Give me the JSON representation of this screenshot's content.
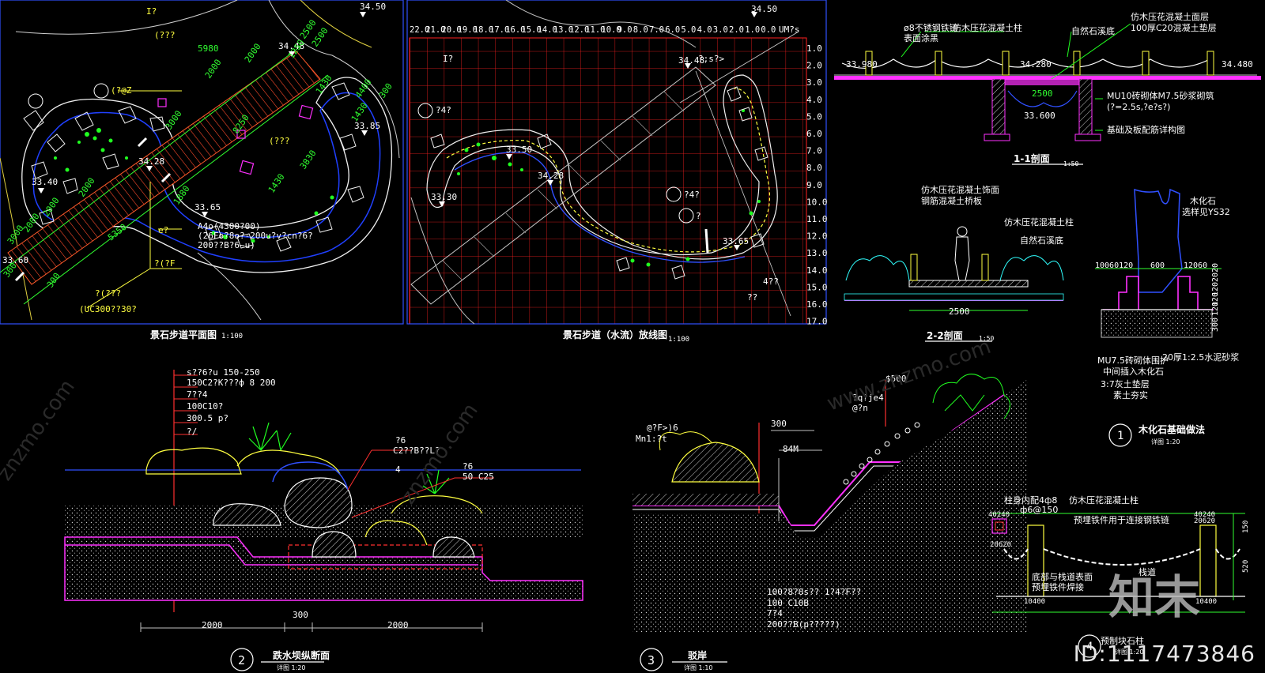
{
  "plan": {
    "title": "景石步道平面图",
    "scale": "1:100",
    "levels": [
      "34.50",
      "34.48",
      "34.28",
      "33.85",
      "33.65",
      "33.40",
      "33.60"
    ],
    "dims": [
      "2500",
      "2500",
      "1250",
      "5980",
      "2000",
      "2000",
      "1430",
      "1430",
      "8250",
      "4400",
      "3830",
      "1430",
      "1880",
      "3000",
      "2000",
      "2000",
      "5350",
      "300",
      "3000",
      "300",
      "300",
      "2000"
    ],
    "notes": [
      "A4o(4300?00)",
      "(26Fo?8o?-200u?v?cn?6?",
      "200??B?6~u)",
      "(UC300??30?",
      "?(???",
      "?(?F",
      "(???",
      "(???",
      "(?@Z",
      "I?",
      "e?"
    ]
  },
  "grid": {
    "title": "景石步道（水流）放线图",
    "scale": "1:100",
    "top_axis": [
      "22.0",
      "21.0",
      "20.0",
      "19.0",
      "18.0",
      "17.0",
      "16.0",
      "15.0",
      "14.0",
      "13.0",
      "12.0",
      "11.0",
      "10.0",
      "9.0",
      "8.0",
      "7.0",
      "6.0",
      "5.0",
      "4.0",
      "3.0",
      "2.0",
      "1.0",
      "0.0"
    ],
    "axis_unit": "UM?s",
    "right_axis": [
      "1.0",
      "2.0",
      "3.0",
      "4.0",
      "5.0",
      "6.0",
      "7.0",
      "8.0",
      "9.0",
      "10.0",
      "11.0",
      "12.0",
      "13.0",
      "14.0",
      "15.0",
      "16.0",
      "17.0"
    ],
    "levels": [
      "34.50",
      "34.48",
      "33.50",
      "34.28",
      "33.30",
      "33.65"
    ],
    "notes": [
      "?;s?>",
      "?4?",
      "?4?",
      "?",
      "4??",
      "??",
      "I?"
    ]
  },
  "section11": {
    "title": "1-1剖面",
    "scale": "1:50",
    "levels": [
      "33.980",
      "34.280",
      "34.480",
      "33.600"
    ],
    "dim": "2500",
    "notes": [
      "ø8不锈钢铁链",
      "仿木压花混凝土柱",
      "表面涂黑",
      "自然石溪底",
      "仿木压花混凝土面层",
      "100厚C20混凝土垫层",
      "MU10砖砌体M7.5砂浆砌筑",
      "(?=2.5s,?e?s?)",
      "基础及板配筋详构图"
    ]
  },
  "section22": {
    "title": "2-2剖面",
    "scale": "1:50",
    "dim": "2500",
    "notes": [
      "仿木压花混凝土饰面",
      "钢筋混凝土桥板",
      "仿木压花混凝土柱",
      "自然石溪底"
    ]
  },
  "detail1": {
    "title": "木化石基础做法",
    "scale": "详图 1:20",
    "num": "1",
    "dims_top": [
      "10060120",
      "600",
      "12060"
    ],
    "dims_side": [
      "2020",
      "120",
      "120",
      "120",
      "300"
    ],
    "label_stone": "木化石",
    "label_sample": "选样见YS32",
    "notes": [
      "MU7.5砖砌体围护",
      "20厚1:2.5水泥砂浆",
      "中间插入木化石",
      "3:7灰土垫层",
      "素土夯实"
    ]
  },
  "detail2": {
    "title": "跌水坝纵断面",
    "scale": "详图 1:20",
    "num": "2",
    "notes": [
      "s??6?u   150-250",
      "150C2?K???ф   8 200",
      "7??4",
      "100C10?",
      "300.5 p?",
      "?/"
    ],
    "callouts": [
      "?6",
      "C2??B??L?",
      "4",
      "?6",
      "50 C25"
    ],
    "dims": [
      "2000",
      "300",
      "2000"
    ]
  },
  "detail3": {
    "title": "驳岸",
    "scale": "详图 1:10",
    "num": "3",
    "notes": [
      "@?F>)6",
      "Mn1:?t",
      "?q?je4",
      "@?n",
      "$500",
      "84M",
      "300"
    ],
    "bottom_notes": [
      "100?8?0s??   1?4?F??",
      "100 C10B",
      "7?4",
      "200??B(p?????)"
    ]
  },
  "detail4": {
    "title": "预制块石柱",
    "scale": "详图 1:20",
    "num": "4",
    "notes": [
      "柱身内配4ф8",
      "ф6@150",
      "仿木压花混凝土柱",
      "预埋铁件用于连接钢铁链",
      "底部与栈道表面",
      "预埋铁件焊接",
      "栈道"
    ],
    "dims": [
      "40240",
      "20620",
      "10400",
      "40240",
      "20620",
      "10400",
      "520",
      "150"
    ]
  },
  "watermarks": [
    "znzmo.com",
    "znzmo.com",
    "www.znzmo.com",
    "知末"
  ],
  "id_tag": "ID:1117473846",
  "colors": {
    "bg": "#000000",
    "red": "#ff3030",
    "green": "#20ff20",
    "yellow": "#ffff40",
    "cyan": "#30ffff",
    "white": "#f0f0f0",
    "magenta": "#ff30ff",
    "blue": "#3040ff",
    "orange": "#d06020"
  }
}
